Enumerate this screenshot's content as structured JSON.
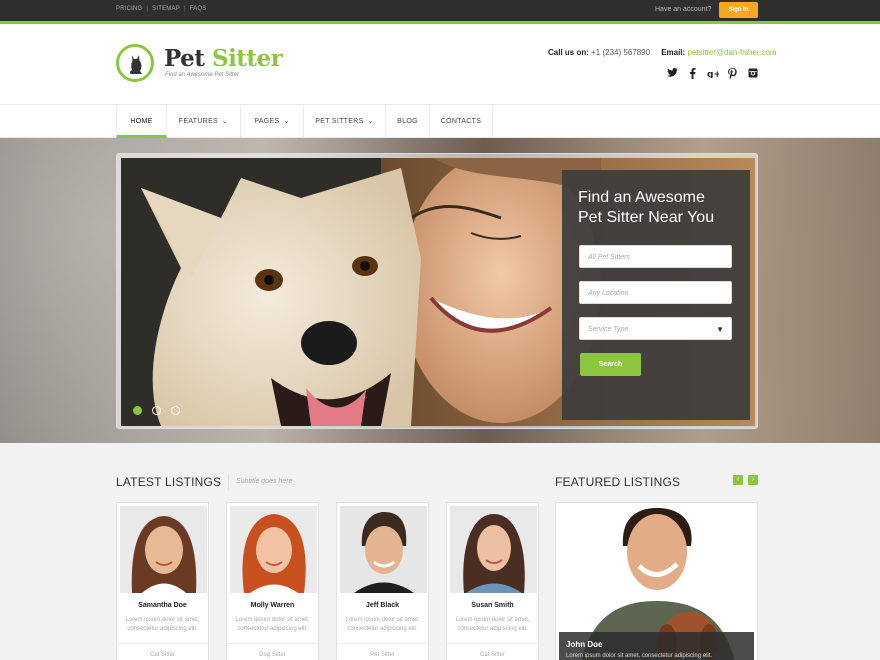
{
  "topbar": {
    "links": [
      "PRICING",
      "SITEMAP",
      "FAQS"
    ],
    "account_text": "Have an account?",
    "signin_label": "Sign In"
  },
  "header": {
    "brand_part1": "Pet ",
    "brand_part2": "Sitter",
    "tagline": "Find an Awesome Pet Sitter",
    "call_label": "Call us on:",
    "phone": "+1 (234) 567890",
    "email_label": "Email:",
    "email": "petsitter@dan-fisher.com",
    "social": [
      "twitter-icon",
      "facebook-icon",
      "google-plus-icon",
      "pinterest-icon",
      "instagram-icon"
    ]
  },
  "nav": {
    "items": [
      {
        "label": "HOME"
      },
      {
        "label": "FEATURES"
      },
      {
        "label": "PAGES"
      },
      {
        "label": "PET SITTERS"
      },
      {
        "label": "BLOG"
      },
      {
        "label": "CONTACTS"
      }
    ]
  },
  "hero": {
    "title_line1": "Find an Awesome",
    "title_line2": "Pet Sitter Near You",
    "field1_placeholder": "All Pet Sitters",
    "field2_placeholder": "Any Location",
    "field3_placeholder": "Service Type",
    "search_label": "Search",
    "slides": 3,
    "active_slide": 1
  },
  "latest": {
    "title": "LATEST LISTINGS",
    "subtitle": "Subtitle goes here",
    "cards": [
      {
        "name": "Samantha Doe",
        "desc": "Lorem ipsum dolor sit amet, consectetur adipiscing elit.",
        "category": "Cat Sitter"
      },
      {
        "name": "Molly Warren",
        "desc": "Lorem ipsum dolor sit amet, consectetur adipiscing elit.",
        "category": "Dog Sitter"
      },
      {
        "name": "Jeff Black",
        "desc": "Lorem ipsum dolor sit amet, consectetur adipiscing elit.",
        "category": "Pet Sitter"
      },
      {
        "name": "Susan Smith",
        "desc": "Lorem ipsum dolor sit amet, consectetur adipiscing elit.",
        "category": "Cat Sitter"
      }
    ]
  },
  "featured": {
    "title": "FEATURED LISTINGS",
    "name": "John Doe",
    "desc": "Lorem ipsum dolor sit amet, consectetur adipiscing elit."
  },
  "colors": {
    "accent": "#8cc63e",
    "signin": "#f7a81b",
    "dark": "#2f2f2f"
  }
}
